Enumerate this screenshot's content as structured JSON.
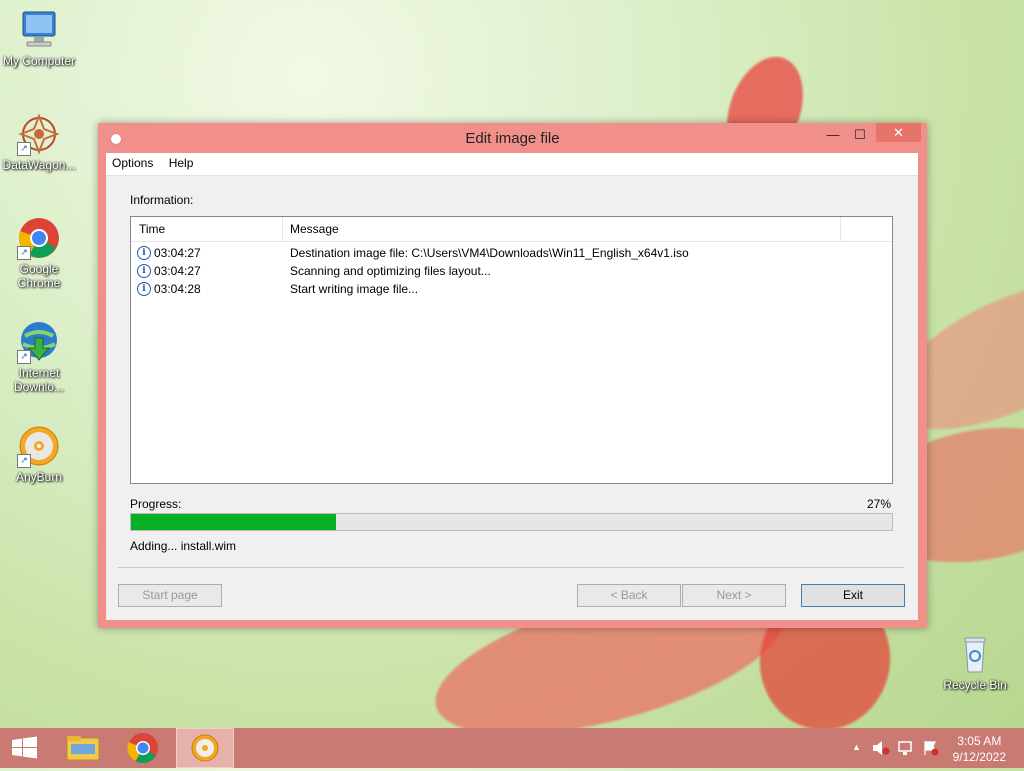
{
  "desktop": {
    "icons": [
      {
        "label": "My Computer"
      },
      {
        "label": "DataWagon..."
      },
      {
        "label": "Google Chrome"
      },
      {
        "label": "Internet Downlo..."
      },
      {
        "label": "AnyBurn"
      }
    ],
    "recycle_bin": {
      "label": "Recycle Bin"
    }
  },
  "window": {
    "title": "Edit image file",
    "controls": {
      "minimize": "—",
      "maximize": "☐",
      "close": "✕"
    },
    "menu": [
      "Options",
      "Help"
    ],
    "information_label": "Information:",
    "list": {
      "columns": [
        "Time",
        "Message"
      ],
      "rows": [
        {
          "time": "03:04:27",
          "message": "Destination image file:  C:\\Users\\VM4\\Downloads\\Win11_English_x64v1.iso"
        },
        {
          "time": "03:04:27",
          "message": "Scanning and optimizing files layout..."
        },
        {
          "time": "03:04:28",
          "message": "Start writing image file..."
        }
      ]
    },
    "progress": {
      "label": "Progress:",
      "percent_text": "27%",
      "value": 27
    },
    "status_text": "Adding...  install.wim",
    "buttons": {
      "start_page": "Start page",
      "back": "< Back",
      "next": "Next >",
      "exit": "Exit"
    }
  },
  "taskbar": {
    "items": [
      "start-button",
      "file-explorer",
      "google-chrome",
      "anyburn"
    ],
    "clock": {
      "time": "3:05 AM",
      "date": "9/12/2022"
    },
    "tray": {
      "up_arrow": "▲"
    }
  },
  "colors": {
    "window_frame": "#f1908a",
    "progress_fill": "#06b025",
    "taskbar": "#c97a72"
  }
}
